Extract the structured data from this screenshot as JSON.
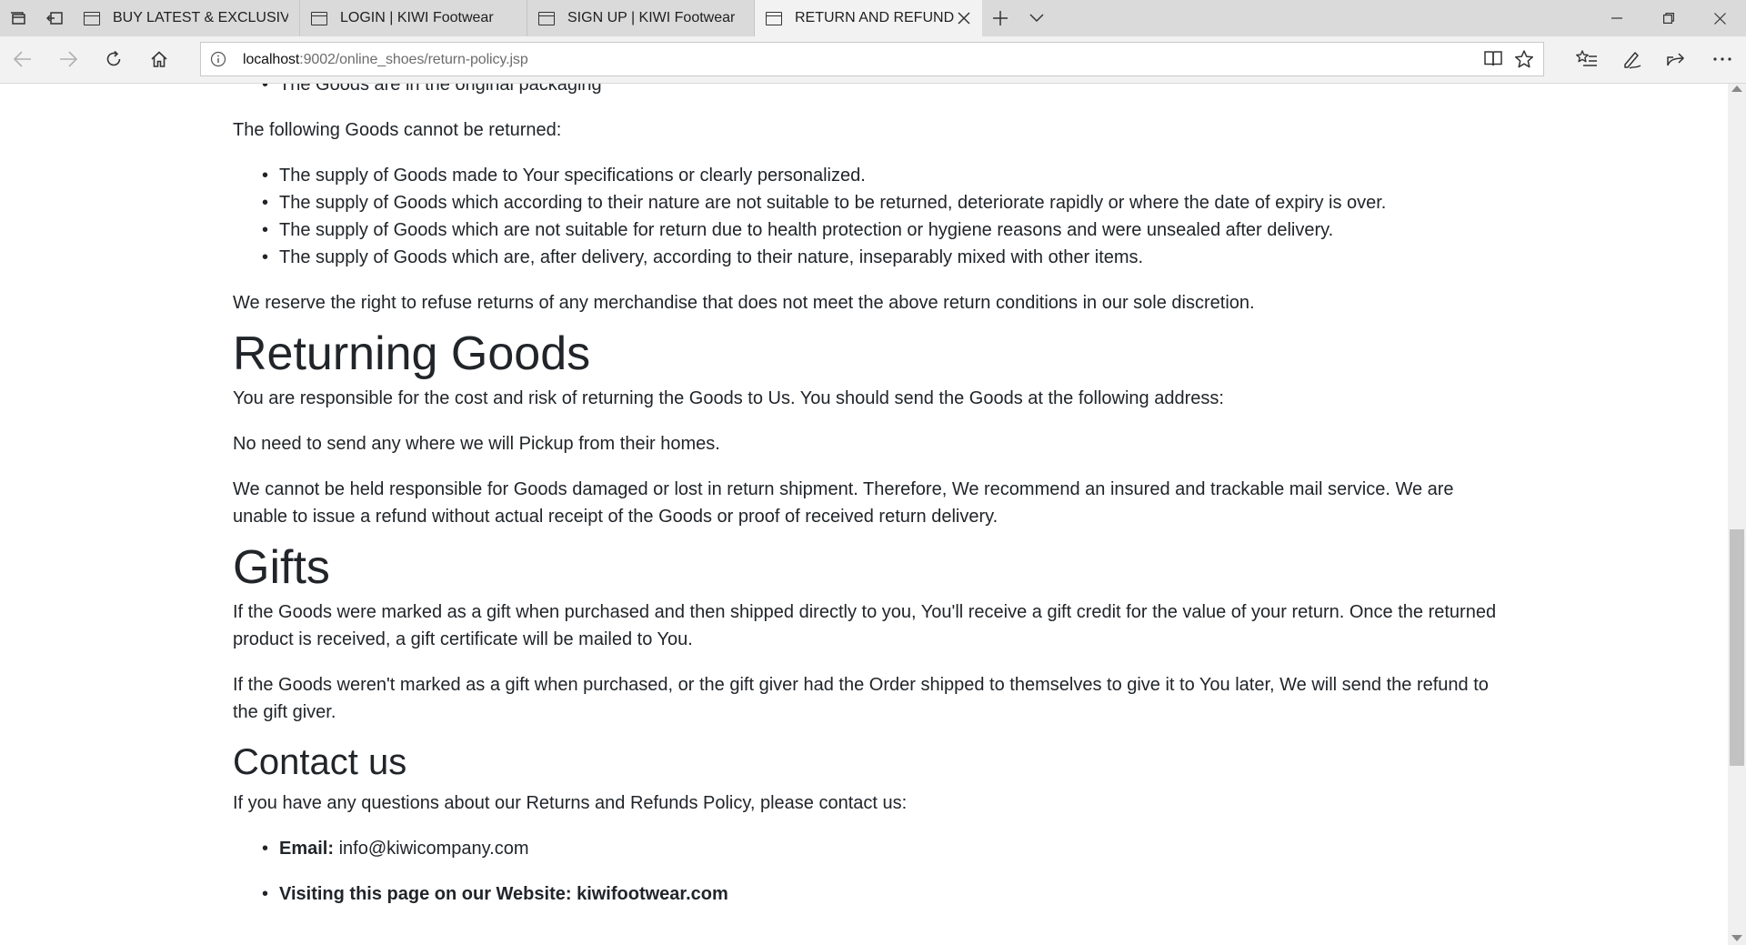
{
  "browser": {
    "tabs": [
      {
        "title": "BUY LATEST & EXCLUSIVE F"
      },
      {
        "title": "LOGIN | KIWI Footwear"
      },
      {
        "title": "SIGN UP | KIWI Footwear"
      },
      {
        "title": "RETURN AND REFUND"
      }
    ],
    "address": {
      "host": "localhost",
      "path": ":9002/online_shoes/return-policy.jsp"
    }
  },
  "page": {
    "cut_item": "The Goods are in the original packaging",
    "nonreturnable_intro": "The following Goods cannot be returned:",
    "nonreturnable_items": [
      "The supply of Goods made to Your specifications or clearly personalized.",
      "The supply of Goods which according to their nature are not suitable to be returned, deteriorate rapidly or where the date of expiry is over.",
      "The supply of Goods which are not suitable for return due to health protection or hygiene reasons and were unsealed after delivery.",
      "The supply of Goods which are, after delivery, according to their nature, inseparably mixed with other items."
    ],
    "reserve_right": "We reserve the right to refuse returns of any merchandise that does not meet the above return conditions in our sole discretion.",
    "returning_heading": "Returning Goods",
    "returning_p1": "You are responsible for the cost and risk of returning the Goods to Us. You should send the Goods at the following address:",
    "returning_p2": "No need to send any where we will Pickup from their homes.",
    "returning_p3": "We cannot be held responsible for Goods damaged or lost in return shipment. Therefore, We recommend an insured and trackable mail service. We are unable to issue a refund without actual receipt of the Goods or proof of received return delivery.",
    "gifts_heading": "Gifts",
    "gifts_p1": "If the Goods were marked as a gift when purchased and then shipped directly to you, You'll receive a gift credit for the value of your return. Once the returned product is received, a gift certificate will be mailed to You.",
    "gifts_p2": "If the Goods weren't marked as a gift when purchased, or the gift giver had the Order shipped to themselves to give it to You later, We will send the refund to the gift giver.",
    "contact_heading": "Contact us",
    "contact_intro": "If you have any questions about our Returns and Refunds Policy, please contact us:",
    "contact_email_label": "Email:",
    "contact_email": "info@kiwicompany.com",
    "contact_website": "Visiting this page on our Website: kiwifootwear.com"
  }
}
